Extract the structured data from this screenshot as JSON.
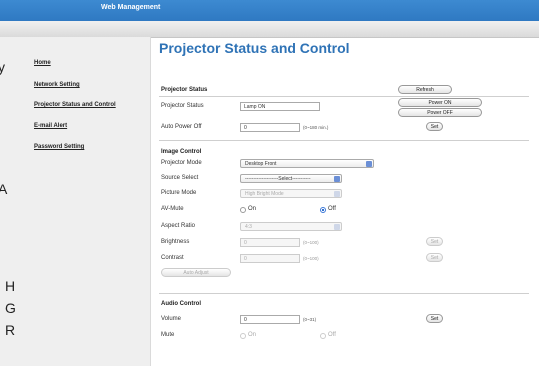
{
  "topbar": {
    "title": "Web Management"
  },
  "sidebar": {
    "items": [
      {
        "label": "Home"
      },
      {
        "label": "Network Setting"
      },
      {
        "label": "Projector Status and Control"
      },
      {
        "label": "E-mail Alert"
      },
      {
        "label": "Password Setting"
      }
    ]
  },
  "edge_glyphs": [
    "y",
    "A",
    "H",
    "G",
    "R"
  ],
  "page": {
    "title": "Projector Status and Control"
  },
  "projector_status": {
    "heading": "Projector Status",
    "refresh_label": "Refresh",
    "status_label": "Projector Status",
    "status_value": "Lamp ON",
    "power_on_label": "Power ON",
    "power_off_label": "Power OFF",
    "auto_power_off_label": "Auto Power Off",
    "auto_power_off_value": "0",
    "auto_power_off_hint": "(0~180 min.)",
    "set_label": "Set"
  },
  "image_control": {
    "heading": "Image Control",
    "projector_mode_label": "Projector Mode",
    "projector_mode_value": "Desktop Front",
    "source_select_label": "Source Select",
    "source_select_value": "--------------------Select-----------",
    "picture_mode_label": "Picture Mode",
    "picture_mode_value": "High Bright Mode",
    "av_mute_label": "AV-Mute",
    "on_label": "On",
    "off_label": "Off",
    "aspect_ratio_label": "Aspect Ratio",
    "aspect_ratio_value": "4:3",
    "brightness_label": "Brightness",
    "brightness_value": "0",
    "brightness_hint": "(0~100)",
    "contrast_label": "Contrast",
    "contrast_value": "0",
    "contrast_hint": "(0~100)",
    "set_label": "Set",
    "auto_adjust_label": "Auto Adjust"
  },
  "audio_control": {
    "heading": "Audio Control",
    "volume_label": "Volume",
    "volume_value": "0",
    "volume_hint": "(0~31)",
    "set_label": "Set",
    "mute_label": "Mute",
    "on_label": "On",
    "off_label": "Off"
  }
}
